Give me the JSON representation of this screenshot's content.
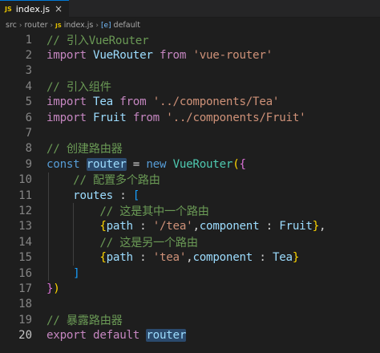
{
  "tab": {
    "icon": "JS",
    "label": "index.js",
    "close": "×"
  },
  "breadcrumb": {
    "parts": [
      "src",
      "router",
      "index.js",
      "default"
    ],
    "sep": "›",
    "file_icon": "JS",
    "symbol_icon": "[e]"
  },
  "lines": [
    {
      "n": "1",
      "tokens": [
        {
          "t": "// 引入VueRouter",
          "c": "comment"
        }
      ]
    },
    {
      "n": "2",
      "tokens": [
        {
          "t": "import",
          "c": "kw2"
        },
        {
          "t": " ",
          "c": "txt"
        },
        {
          "t": "VueRouter",
          "c": "var"
        },
        {
          "t": " ",
          "c": "txt"
        },
        {
          "t": "from",
          "c": "kw2"
        },
        {
          "t": " ",
          "c": "txt"
        },
        {
          "t": "'vue-router'",
          "c": "str"
        }
      ]
    },
    {
      "n": "3",
      "tokens": []
    },
    {
      "n": "4",
      "tokens": [
        {
          "t": "// 引入组件",
          "c": "comment"
        }
      ]
    },
    {
      "n": "5",
      "tokens": [
        {
          "t": "import",
          "c": "kw2"
        },
        {
          "t": " ",
          "c": "txt"
        },
        {
          "t": "Tea",
          "c": "var"
        },
        {
          "t": " ",
          "c": "txt"
        },
        {
          "t": "from",
          "c": "kw2"
        },
        {
          "t": " ",
          "c": "txt"
        },
        {
          "t": "'../components/Tea'",
          "c": "str"
        }
      ]
    },
    {
      "n": "6",
      "tokens": [
        {
          "t": "import",
          "c": "kw2"
        },
        {
          "t": " ",
          "c": "txt"
        },
        {
          "t": "Fruit",
          "c": "var"
        },
        {
          "t": " ",
          "c": "txt"
        },
        {
          "t": "from",
          "c": "kw2"
        },
        {
          "t": " ",
          "c": "txt"
        },
        {
          "t": "'../components/Fruit'",
          "c": "str"
        }
      ]
    },
    {
      "n": "7",
      "tokens": []
    },
    {
      "n": "8",
      "tokens": [
        {
          "t": "// 创建路由器",
          "c": "comment"
        }
      ]
    },
    {
      "n": "9",
      "tokens": [
        {
          "t": "const",
          "c": "kw"
        },
        {
          "t": " ",
          "c": "txt"
        },
        {
          "t": "router",
          "c": "var",
          "hl": true
        },
        {
          "t": " = ",
          "c": "txt"
        },
        {
          "t": "new",
          "c": "kw"
        },
        {
          "t": " ",
          "c": "txt"
        },
        {
          "t": "VueRouter",
          "c": "cls"
        },
        {
          "t": "(",
          "c": "b1"
        },
        {
          "t": "{",
          "c": "b2"
        }
      ]
    },
    {
      "n": "10",
      "tokens": [
        {
          "t": "    ",
          "c": "txt"
        },
        {
          "t": "// 配置多个路由",
          "c": "comment"
        }
      ]
    },
    {
      "n": "11",
      "tokens": [
        {
          "t": "    ",
          "c": "txt"
        },
        {
          "t": "routes",
          "c": "var"
        },
        {
          "t": " : ",
          "c": "txt"
        },
        {
          "t": "[",
          "c": "b3"
        }
      ]
    },
    {
      "n": "12",
      "tokens": [
        {
          "t": "        ",
          "c": "txt"
        },
        {
          "t": "// 这是其中一个路由",
          "c": "comment"
        }
      ]
    },
    {
      "n": "13",
      "tokens": [
        {
          "t": "        ",
          "c": "txt"
        },
        {
          "t": "{",
          "c": "b1"
        },
        {
          "t": "path",
          "c": "var"
        },
        {
          "t": " : ",
          "c": "txt"
        },
        {
          "t": "'/tea'",
          "c": "str"
        },
        {
          "t": ",",
          "c": "txt"
        },
        {
          "t": "component",
          "c": "var"
        },
        {
          "t": " : ",
          "c": "txt"
        },
        {
          "t": "Fruit",
          "c": "var"
        },
        {
          "t": "}",
          "c": "b1"
        },
        {
          "t": ",",
          "c": "txt"
        }
      ]
    },
    {
      "n": "14",
      "tokens": [
        {
          "t": "        ",
          "c": "txt"
        },
        {
          "t": "// 这是另一个路由",
          "c": "comment"
        }
      ]
    },
    {
      "n": "15",
      "tokens": [
        {
          "t": "        ",
          "c": "txt"
        },
        {
          "t": "{",
          "c": "b1"
        },
        {
          "t": "path",
          "c": "var"
        },
        {
          "t": " : ",
          "c": "txt"
        },
        {
          "t": "'tea'",
          "c": "str"
        },
        {
          "t": ",",
          "c": "txt"
        },
        {
          "t": "component",
          "c": "var"
        },
        {
          "t": " : ",
          "c": "txt"
        },
        {
          "t": "Tea",
          "c": "var"
        },
        {
          "t": "}",
          "c": "b1"
        }
      ]
    },
    {
      "n": "16",
      "tokens": [
        {
          "t": "    ",
          "c": "txt"
        },
        {
          "t": "]",
          "c": "b3"
        }
      ]
    },
    {
      "n": "17",
      "tokens": [
        {
          "t": "}",
          "c": "b2"
        },
        {
          "t": ")",
          "c": "b1"
        }
      ]
    },
    {
      "n": "18",
      "tokens": []
    },
    {
      "n": "19",
      "tokens": [
        {
          "t": "// 暴露路由器",
          "c": "comment"
        }
      ]
    },
    {
      "n": "20",
      "tokens": [
        {
          "t": "export",
          "c": "kw2"
        },
        {
          "t": " ",
          "c": "txt"
        },
        {
          "t": "default",
          "c": "kw2"
        },
        {
          "t": " ",
          "c": "txt"
        },
        {
          "t": "router",
          "c": "var",
          "hl": true
        }
      ],
      "active": true
    }
  ]
}
